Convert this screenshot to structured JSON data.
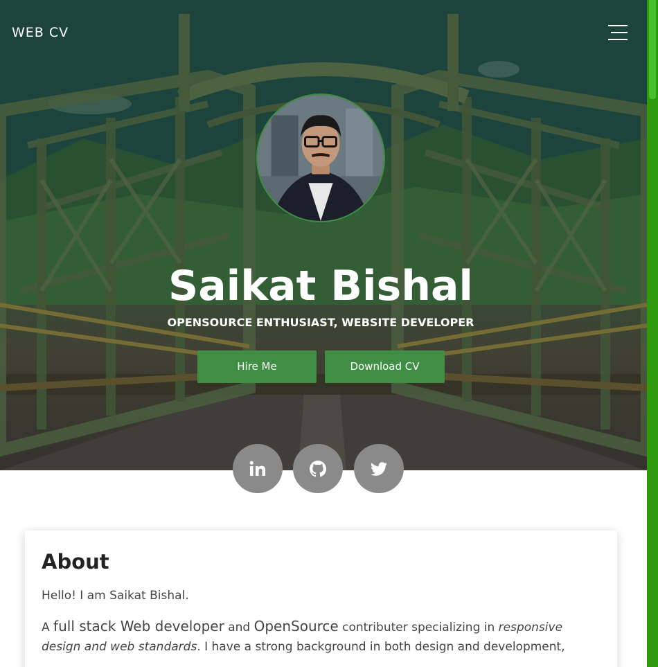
{
  "nav": {
    "brand": "WEB CV",
    "menu_icon": "hamburger-menu-icon"
  },
  "hero": {
    "name": "Saikat Bishal",
    "tagline": "OPENSOURCE ENTHUSIAST, WEBSITE DEVELOPER",
    "hire_label": "Hire Me",
    "download_label": "Download CV"
  },
  "social": [
    {
      "icon": "linkedin-icon"
    },
    {
      "icon": "github-icon"
    },
    {
      "icon": "twitter-icon"
    }
  ],
  "about": {
    "title": "About",
    "greeting": "Hello! I am Saikat Bishal.",
    "desc_part1": "A ",
    "desc_big1": "full stack Web developer",
    "desc_part2": " and ",
    "desc_big2": "OpenSource",
    "desc_part3": " contributer specializing in ",
    "desc_italic": "responsive design and web standards",
    "desc_part4": ". I have a strong background in both design and development,"
  },
  "colors": {
    "accent": "#3f8e43",
    "social_bg": "#8a8a8a",
    "scrollbar_track": "#2f9a0e",
    "scrollbar_thumb": "#48c22a"
  }
}
